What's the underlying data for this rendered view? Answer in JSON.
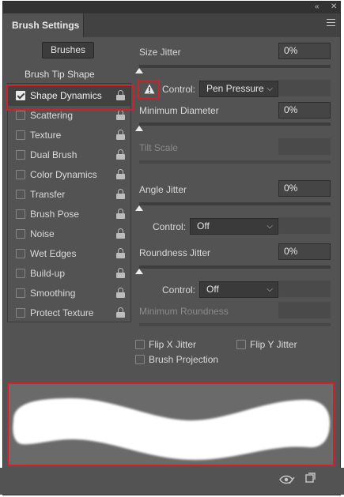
{
  "panel": {
    "title": "Brush Settings",
    "collapse_icon": "double-chevron-icon",
    "close_icon": "close-icon",
    "menu_icon": "hamburger-menu-icon"
  },
  "brushes_button": "Brushes",
  "brush_tip_shape": "Brush Tip Shape",
  "options": [
    {
      "label": "Shape Dynamics",
      "checked": true,
      "selected": true
    },
    {
      "label": "Scattering",
      "checked": false
    },
    {
      "label": "Texture",
      "checked": false
    },
    {
      "label": "Dual Brush",
      "checked": false
    },
    {
      "label": "Color Dynamics",
      "checked": false
    },
    {
      "label": "Transfer",
      "checked": false
    },
    {
      "label": "Brush Pose",
      "checked": false
    },
    {
      "label": "Noise",
      "checked": false
    },
    {
      "label": "Wet Edges",
      "checked": false
    },
    {
      "label": "Build-up",
      "checked": false
    },
    {
      "label": "Smoothing",
      "checked": false
    },
    {
      "label": "Protect Texture",
      "checked": false
    }
  ],
  "size_jitter": {
    "label": "Size Jitter",
    "value": "0%",
    "slider": 0
  },
  "size_control": {
    "label": "Control:",
    "value": "Pen Pressure",
    "warning_icon": "warning-icon"
  },
  "min_diameter": {
    "label": "Minimum Diameter",
    "value": "0%",
    "slider": 0
  },
  "tilt_scale": {
    "label": "Tilt Scale",
    "value": ""
  },
  "angle_jitter": {
    "label": "Angle Jitter",
    "value": "0%",
    "slider": 0
  },
  "angle_control": {
    "label": "Control:",
    "value": "Off"
  },
  "roundness_jitter": {
    "label": "Roundness Jitter",
    "value": "0%",
    "slider": 0
  },
  "roundness_control": {
    "label": "Control:",
    "value": "Off"
  },
  "min_roundness": {
    "label": "Minimum Roundness",
    "value": ""
  },
  "flip_x": {
    "label": "Flip X Jitter",
    "checked": false
  },
  "flip_y": {
    "label": "Flip Y Jitter",
    "checked": false
  },
  "brush_projection": {
    "label": "Brush Projection",
    "checked": false
  },
  "footer": {
    "toggle_icon": "eye-toggle-icon",
    "new_icon": "new-preset-icon"
  },
  "colors": {
    "highlight": "#d0202a",
    "panel_bg": "#535353",
    "preview_bg": "#6a6a6a"
  }
}
